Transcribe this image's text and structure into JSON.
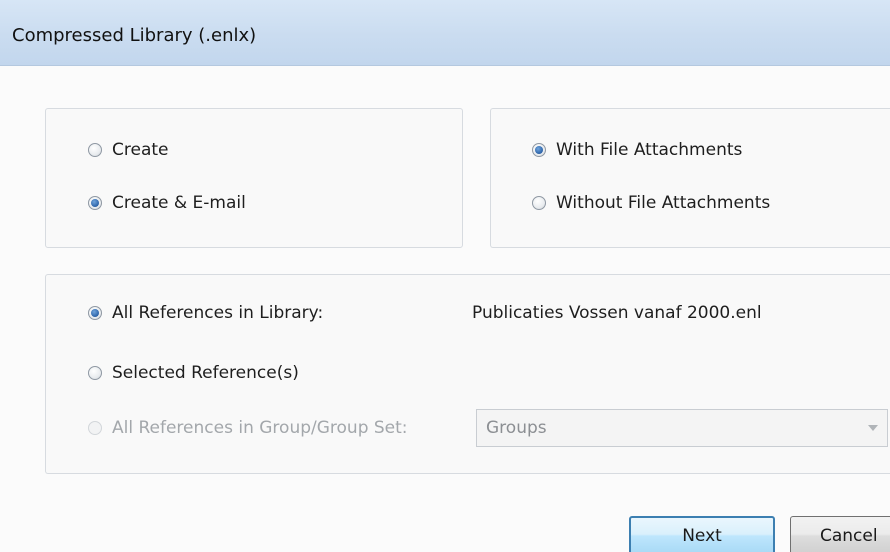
{
  "window": {
    "title": "Compressed Library (.enlx)"
  },
  "action_group": {
    "create": {
      "label": "Create",
      "selected": false
    },
    "create_email": {
      "label": "Create & E-mail",
      "selected": true
    }
  },
  "attachments_group": {
    "with": {
      "label": "With File Attachments",
      "selected": true
    },
    "without": {
      "label": "Without File Attachments",
      "selected": false
    }
  },
  "references_group": {
    "all": {
      "label": "All References in Library:",
      "selected": true
    },
    "library_name": "Publicaties Vossen vanaf 2000.enl",
    "selected": {
      "label": "Selected Reference(s)",
      "selected": false
    },
    "group_set": {
      "label": "All References in Group/Group Set:",
      "selected": false,
      "disabled": true
    },
    "groups_select": {
      "value": "Groups",
      "disabled": true
    }
  },
  "buttons": {
    "next": "Next",
    "cancel": "Cancel"
  },
  "colors": {
    "titlebar": "#cadcf0",
    "radio_selected": "#2c62a8",
    "next_border": "#3c7fb1",
    "disabled_text": "#a3a7ab"
  }
}
